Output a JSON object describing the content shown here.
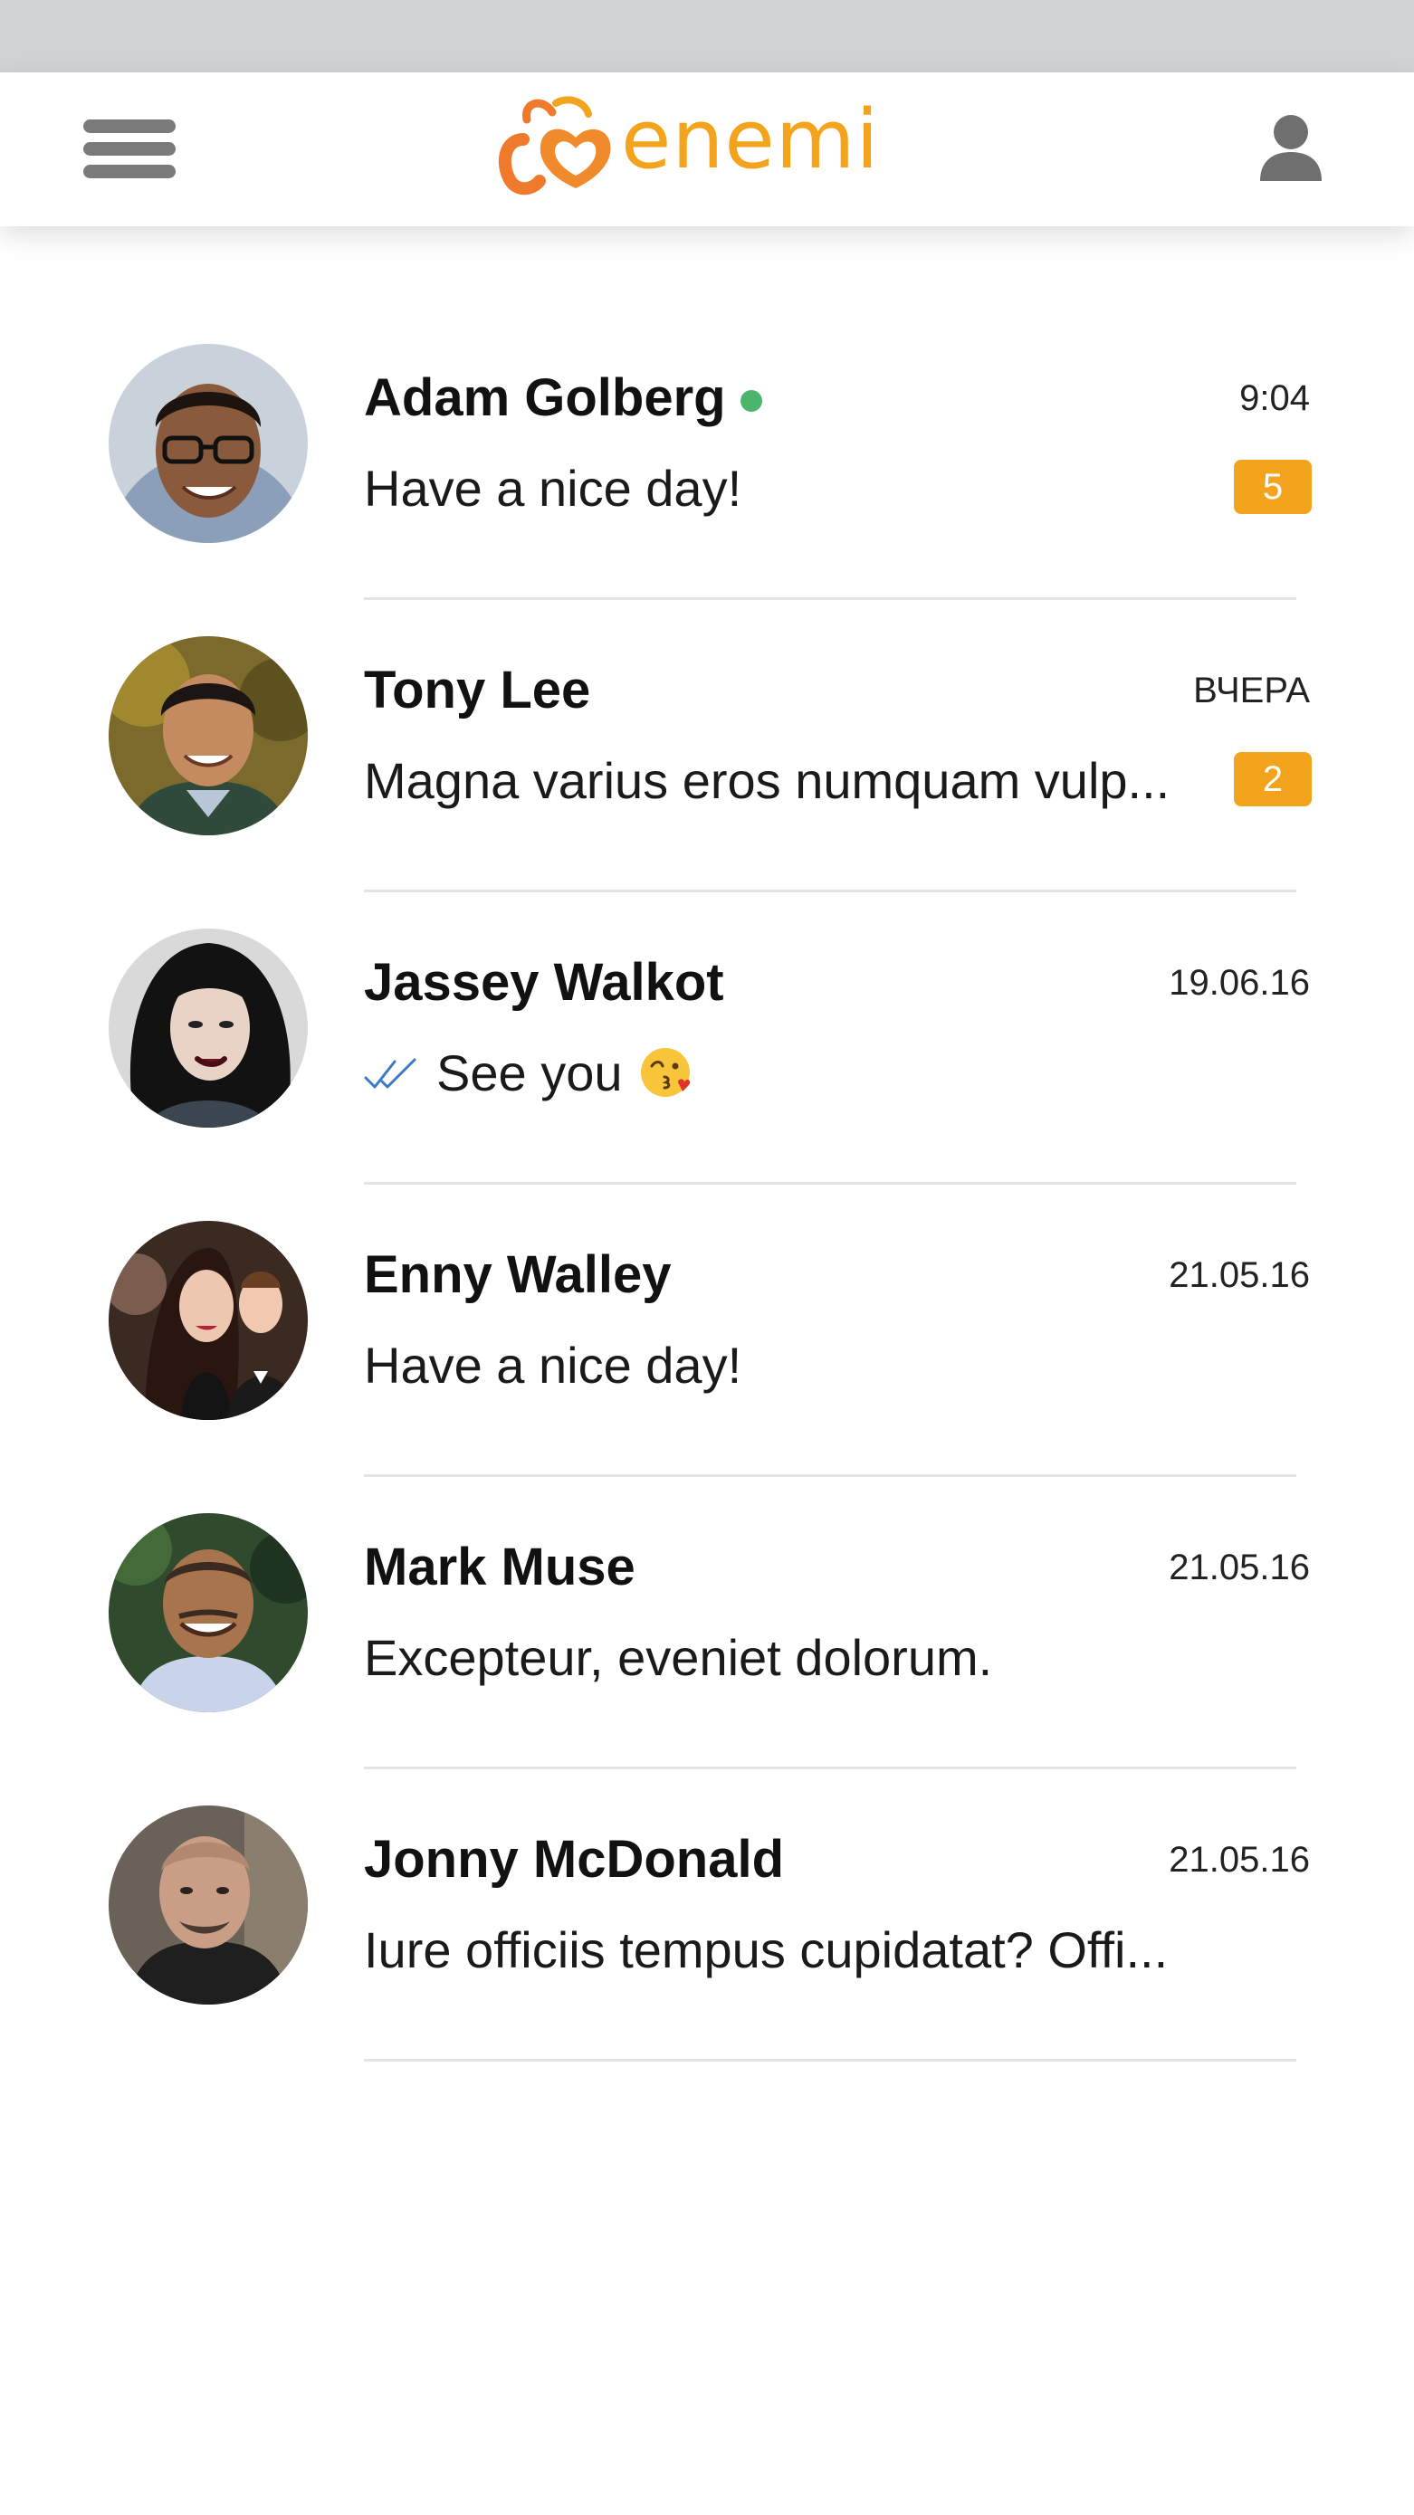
{
  "header": {
    "logo_text": "enemi",
    "brand_color": "#f4a41c",
    "menu_icon": "hamburger-menu-icon",
    "profile_icon": "user-profile-icon"
  },
  "chats": [
    {
      "name": "Adam Golberg",
      "online": true,
      "time": "9:04",
      "message": "Have a nice day!",
      "unread": "5",
      "read_receipt": false,
      "emoji": ""
    },
    {
      "name": "Tony Lee",
      "online": false,
      "time": "ВЧЕРА",
      "message": "Magna varius eros numquam vulp...",
      "unread": "2",
      "read_receipt": false,
      "emoji": ""
    },
    {
      "name": "Jassey Walkot",
      "online": false,
      "time": "19.06.16",
      "message": "See you",
      "unread": "",
      "read_receipt": true,
      "emoji": "kissing-face-icon"
    },
    {
      "name": "Enny Walley",
      "online": false,
      "time": "21.05.16",
      "message": "Have a nice day!",
      "unread": "",
      "read_receipt": false,
      "emoji": ""
    },
    {
      "name": "Mark Muse",
      "online": false,
      "time": "21.05.16",
      "message": "Excepteur, eveniet dolorum.",
      "unread": "",
      "read_receipt": false,
      "emoji": ""
    },
    {
      "name": "Jonny McDonald",
      "online": false,
      "time": "21.05.16",
      "message": "Iure officiis tempus cupidatat? Offi...",
      "unread": "",
      "read_receipt": false,
      "emoji": ""
    }
  ],
  "colors": {
    "accent": "#f4a41c",
    "online": "#4cb56c",
    "divider": "#e4e4e4",
    "status_bar": "#d1d2d6"
  }
}
